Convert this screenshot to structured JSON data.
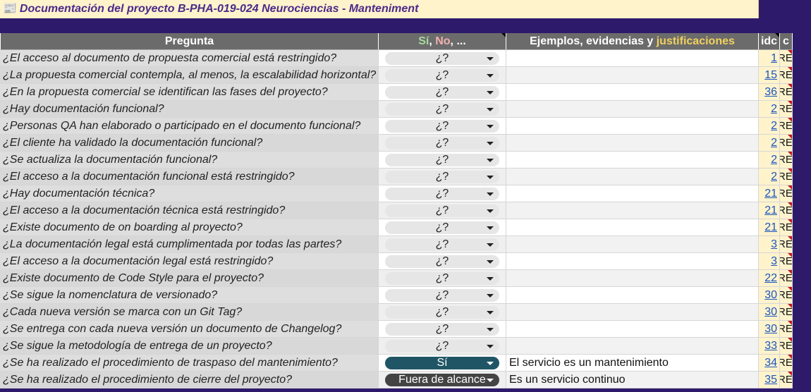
{
  "title": {
    "icon": "📰",
    "text": "Documentación del proyecto B-PHA-019-024 Neurociencias - Manteniment"
  },
  "headers": {
    "pregunta": "Pregunta",
    "answer_si": "Sí",
    "answer_sep1": ", ",
    "answer_no": "No",
    "answer_rest": ", ...",
    "evidence_main": "Ejemplos, evidencias y ",
    "evidence_hl": "justificaciones",
    "idc": "idc",
    "c": "c"
  },
  "rows": [
    {
      "q": "¿El acceso al documento de propuesta comercial está restringido?",
      "a": "¿?",
      "ev": "",
      "idc": "1",
      "c": "REF!"
    },
    {
      "q": "¿La propuesta comercial contempla, al menos, la escalabilidad horizontal?",
      "a": "¿?",
      "ev": "",
      "idc": "15",
      "c": "REF!"
    },
    {
      "q": "¿En la propuesta comercial se identifican las fases del proyecto?",
      "a": "¿?",
      "ev": "",
      "idc": "36",
      "c": "REF!"
    },
    {
      "q": "¿Hay documentación funcional?",
      "a": "¿?",
      "ev": "",
      "idc": "2",
      "c": "REF!"
    },
    {
      "q": "¿Personas QA han elaborado o participado en el documento funcional?",
      "a": "¿?",
      "ev": "",
      "idc": "2",
      "c": "REF!"
    },
    {
      "q": "¿El cliente ha validado la documentación funcional?",
      "a": "¿?",
      "ev": "",
      "idc": "2",
      "c": "REF!"
    },
    {
      "q": "¿Se actualiza la documentación funcional?",
      "a": "¿?",
      "ev": "",
      "idc": "2",
      "c": "REF!"
    },
    {
      "q": "¿El acceso a la documentación funcional está restringido?",
      "a": "¿?",
      "ev": "",
      "idc": "2",
      "c": "REF!"
    },
    {
      "q": "¿Hay documentación técnica?",
      "a": "¿?",
      "ev": "",
      "idc": "21",
      "c": "REF!"
    },
    {
      "q": "¿El acceso a la documentación técnica está restringido?",
      "a": "¿?",
      "ev": "",
      "idc": "21",
      "c": "REF!"
    },
    {
      "q": "¿Existe documento de on boarding al proyecto?",
      "a": "¿?",
      "ev": "",
      "idc": "21",
      "c": "REF!"
    },
    {
      "q": "¿La documentación legal está cumplimentada por todas las partes?",
      "a": "¿?",
      "ev": "",
      "idc": "3",
      "c": "REF!"
    },
    {
      "q": "¿El acceso a la documentación legal está restringido?",
      "a": "¿?",
      "ev": "",
      "idc": "3",
      "c": "REF!"
    },
    {
      "q": "¿Existe documento de Code Style para el proyecto?",
      "a": "¿?",
      "ev": "",
      "idc": "22",
      "c": "REF!"
    },
    {
      "q": "¿Se sigue la nomenclatura de versionado?",
      "a": "¿?",
      "ev": "",
      "idc": "30",
      "c": "REF!"
    },
    {
      "q": "¿Cada nueva versión se marca con un Git Tag?",
      "a": "¿?",
      "ev": "",
      "idc": "30",
      "c": "REF!"
    },
    {
      "q": "¿Se entrega con cada nueva versión un documento de Changelog?",
      "a": "¿?",
      "ev": "",
      "idc": "30",
      "c": "REF!"
    },
    {
      "q": "¿Se sigue la metodología de entrega de un proyecto?",
      "a": "¿?",
      "ev": "",
      "idc": "33",
      "c": "REF!"
    },
    {
      "q": "¿Se ha realizado el procedimiento de traspaso del mantenimiento?",
      "a": "Sí",
      "ev": "El servicio es un mantenimiento",
      "idc": "34",
      "c": "REF!"
    },
    {
      "q": "¿Se ha realizado el procedimiento de cierre del proyecto?",
      "a": "Fuera de alcance",
      "ev": "Es un servicio continuo",
      "idc": "35",
      "c": "REF!"
    }
  ],
  "colors": {
    "background": "#2e1a6b",
    "header": "#6b6b6b",
    "title_bg": "#fff3cc",
    "answer_si": "#205566",
    "answer_fuera": "#444444",
    "link": "#1a55c0"
  }
}
